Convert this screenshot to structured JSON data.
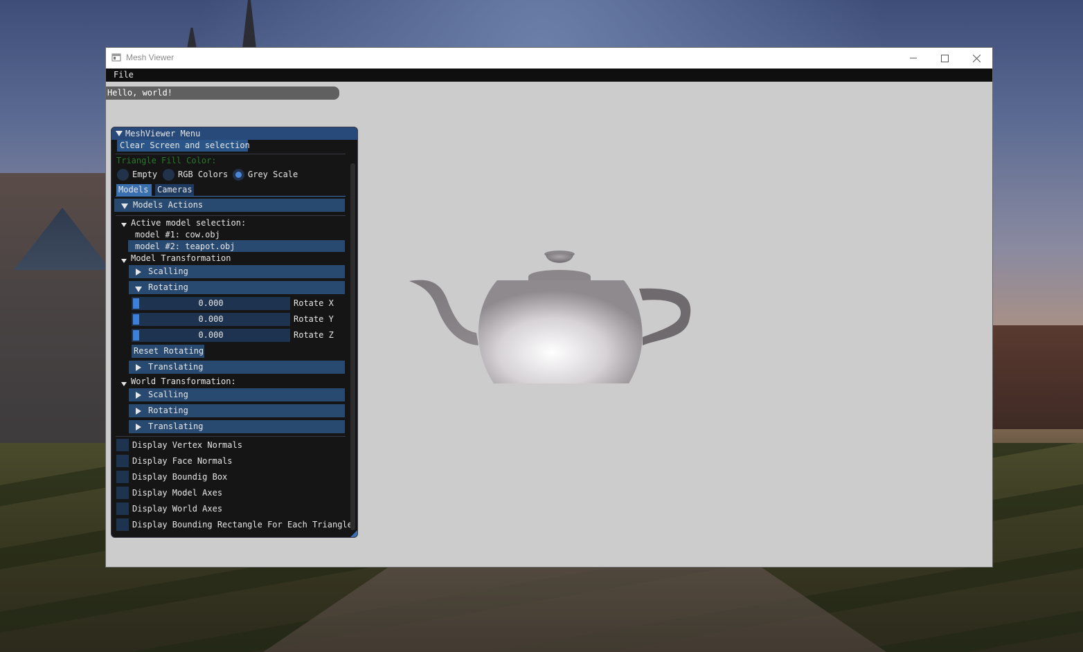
{
  "window": {
    "title": "Mesh Viewer",
    "controls": {
      "minimize": "–",
      "maximize": "☐",
      "close": "✕"
    }
  },
  "menubar": {
    "items": [
      {
        "label": "File"
      }
    ]
  },
  "status": {
    "text": "Hello, world!"
  },
  "panel": {
    "title": "MeshViewer Menu",
    "clear_button": "Clear Screen and selection",
    "fill_color_label": "Triangle Fill Color:",
    "fill_options": [
      {
        "label": "Empty",
        "selected": false
      },
      {
        "label": "RGB Colors",
        "selected": false
      },
      {
        "label": "Grey Scale",
        "selected": true
      }
    ],
    "tabs": [
      {
        "label": "Models",
        "active": true
      },
      {
        "label": "Cameras",
        "active": false
      }
    ],
    "models_actions": "Models Actions",
    "active_model_selection": "Active model selection:",
    "models": [
      {
        "label": "model #1: cow.obj",
        "selected": false
      },
      {
        "label": "model #2: teapot.obj",
        "selected": true
      }
    ],
    "model_transformation": "Model Transformation",
    "scalling": "Scalling",
    "rotating": "Rotating",
    "translating": "Translating",
    "rotate_sliders": [
      {
        "label": "Rotate X",
        "value": "0.000",
        "fraction": 0.0
      },
      {
        "label": "Rotate Y",
        "value": "0.000",
        "fraction": 0.0
      },
      {
        "label": "Rotate Z",
        "value": "0.000",
        "fraction": 0.0
      }
    ],
    "reset_rotating": "Reset Rotating",
    "world_transformation": "World Transformation:",
    "world_scalling": "Scalling",
    "world_rotating": "Rotating",
    "world_translating": "Translating",
    "checkboxes": [
      {
        "label": "Display Vertex Normals",
        "checked": false
      },
      {
        "label": "Display Face Normals",
        "checked": false
      },
      {
        "label": "Display Boundig Box",
        "checked": false
      },
      {
        "label": "Display Model Axes",
        "checked": false
      },
      {
        "label": "Display World Axes",
        "checked": false
      },
      {
        "label": "Display Bounding Rectangle For Each Triangle",
        "checked": false
      }
    ]
  },
  "colors": {
    "viewport_bg": "#cccccc",
    "panel_bg": "#151515",
    "header_blue": "#294a70",
    "accent_blue": "#3d80d8",
    "fill_label_green": "#2a7a2a"
  }
}
